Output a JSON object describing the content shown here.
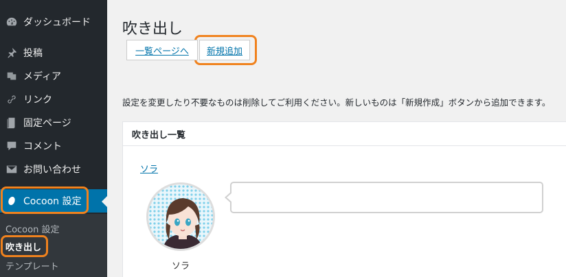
{
  "sidebar": {
    "items": [
      {
        "label": "ダッシュボード",
        "icon": "dashboard-icon"
      },
      {
        "label": "投稿",
        "icon": "pin-icon"
      },
      {
        "label": "メディア",
        "icon": "media-icon"
      },
      {
        "label": "リンク",
        "icon": "link-icon"
      },
      {
        "label": "固定ページ",
        "icon": "page-icon"
      },
      {
        "label": "コメント",
        "icon": "comment-icon"
      },
      {
        "label": "お問い合わせ",
        "icon": "mail-icon"
      },
      {
        "label": "Cocoon 設定",
        "icon": "cocoon-icon"
      }
    ],
    "submenu": [
      "Cocoon 設定",
      "吹き出し",
      "テンプレート"
    ]
  },
  "main": {
    "title": "吹き出し",
    "tabs": [
      "一覧ページへ",
      "新規追加"
    ],
    "notice": "設定を変更したり不要なものは削除してご利用ください。新しいものは「新規作成」ボタンから追加できます。",
    "panel": {
      "title": "吹き出し一覧",
      "balloon_link": "ソラ",
      "avatar_name": "ソラ"
    }
  },
  "colors": {
    "accent": "#0073aa",
    "highlight": "#f0821e",
    "sidebar_bg": "#23282d"
  }
}
